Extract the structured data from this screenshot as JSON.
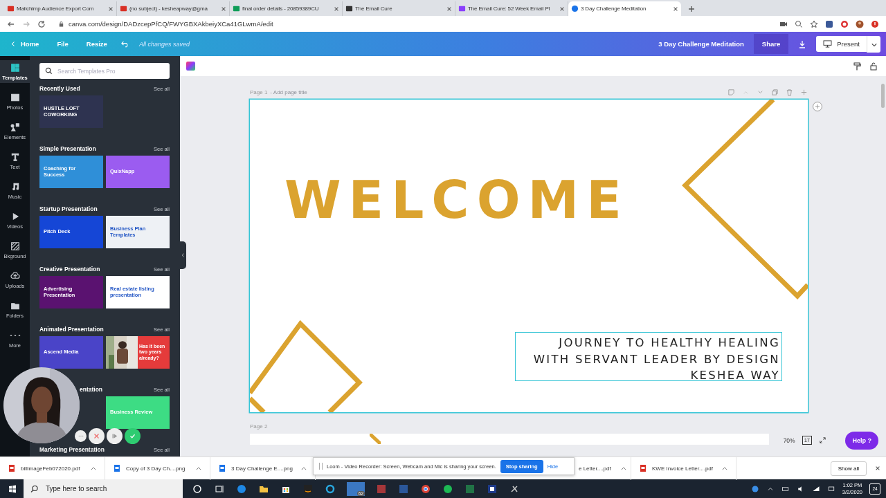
{
  "browser": {
    "tabs": [
      {
        "title": "Mailchimp Audience Export Com",
        "kind": "gmail",
        "selected": false
      },
      {
        "title": "(no subject) - kesheapway@gma",
        "kind": "gmail",
        "selected": false
      },
      {
        "title": "final order details - 20859389CU",
        "kind": "sheet",
        "selected": false
      },
      {
        "title": "The Email Cure",
        "kind": "mail",
        "selected": false
      },
      {
        "title": "The Email Cure: 52 Week Email Pl",
        "kind": "trello",
        "selected": false
      },
      {
        "title": "3 Day Challenge Meditation",
        "kind": "canva",
        "selected": true
      }
    ],
    "address": "canva.com/design/DADzcepPfCQ/FWYGBXAkbeiyXCa41GLwmA/edit"
  },
  "header": {
    "home": "Home",
    "file": "File",
    "resize": "Resize",
    "status": "All changes saved",
    "design_title": "3 Day Challenge Meditation",
    "share": "Share",
    "present": "Present"
  },
  "rail": [
    {
      "label": "Templates",
      "kind": "templates",
      "selected": true
    },
    {
      "label": "Photos",
      "kind": "photos",
      "selected": false
    },
    {
      "label": "Elements",
      "kind": "elements",
      "selected": false
    },
    {
      "label": "Text",
      "kind": "text",
      "selected": false
    },
    {
      "label": "Music",
      "kind": "music",
      "selected": false
    },
    {
      "label": "Videos",
      "kind": "videos",
      "selected": false
    },
    {
      "label": "Bkground",
      "kind": "background",
      "selected": false
    },
    {
      "label": "Uploads",
      "kind": "uploads",
      "selected": false
    },
    {
      "label": "Folders",
      "kind": "folders",
      "selected": false
    },
    {
      "label": "More",
      "kind": "more",
      "selected": false
    }
  ],
  "panel": {
    "search_placeholder": "Search Templates Pro",
    "sections": [
      {
        "title": "Recently Used",
        "see_all": "See all",
        "thumbs": [
          {
            "text": "HUSTLE LOFT COWORKING",
            "color": "#2e3350",
            "kind": "dark"
          }
        ]
      },
      {
        "title": "Simple Presentation",
        "see_all": "See all",
        "thumbs": [
          {
            "text": "Coaching for Success",
            "color": "#2f8fd8",
            "kind": "dark"
          },
          {
            "text": "QuixNapp",
            "color": "#9b5cf0",
            "kind": "dark"
          }
        ]
      },
      {
        "title": "Startup Presentation",
        "see_all": "See all",
        "thumbs": [
          {
            "text": "Pitch Deck",
            "color": "#1546d6",
            "kind": "dark"
          },
          {
            "text": "Business Plan Templates",
            "color": "#eef1f5",
            "kind": "light"
          }
        ]
      },
      {
        "title": "Creative Presentation",
        "see_all": "See all",
        "thumbs": [
          {
            "text": "Advertising Presentation",
            "color": "#5a1270",
            "kind": "dark"
          },
          {
            "text": "Real estate listing presentation",
            "color": "#ffffff",
            "kind": "light"
          }
        ]
      },
      {
        "title": "Animated Presentation",
        "see_all": "See all",
        "thumbs": [
          {
            "text": "Ascend Media",
            "color": "#4a44c8",
            "kind": "dark"
          },
          {
            "text": "Has it been two years already?",
            "color": "#e53b3b"
          }
        ]
      },
      {
        "title": "entation",
        "see_all": "See all",
        "covered": true,
        "thumbs": [
          {
            "text": "Business Review",
            "color": "#3ddc84",
            "kind": "dark"
          }
        ]
      },
      {
        "title": "Marketing Presentation",
        "see_all": "See all"
      }
    ]
  },
  "canvas": {
    "page_label": "Page 1",
    "page_title_placeholder": "- Add page title",
    "slide": {
      "heading": "WELCOME",
      "subtitle": [
        "JOURNEY TO HEALTHY HEALING",
        "WITH SERVANT LEADER BY DESIGN",
        "KESHEA WAY"
      ]
    },
    "next_page_label": "Page 2",
    "zoom": "70%",
    "page_count": "17",
    "help": "Help ?"
  },
  "downloads": {
    "items": [
      {
        "name": "billimageFeb072020.pdf",
        "kind": "pdf"
      },
      {
        "name": "Copy of 3 Day Ch....png",
        "kind": "png"
      },
      {
        "name": "3 Day Challenge E....png",
        "kind": "png"
      },
      {
        "name": "e Letter....pdf",
        "kind": "partial"
      },
      {
        "name": "KWE Invoice Letter....pdf",
        "kind": "pdf"
      }
    ],
    "show_all": "Show all"
  },
  "loom": {
    "message": "Loom - Video Recorder: Screen, Webcam and Mic is sharing your screen.",
    "stop": "Stop sharing",
    "hide": "Hide"
  },
  "taskbar": {
    "search_placeholder": "Type here to search",
    "mail_badge": "62",
    "time": "1:02 PM",
    "date": "3/2/2020",
    "notifications": "24"
  }
}
